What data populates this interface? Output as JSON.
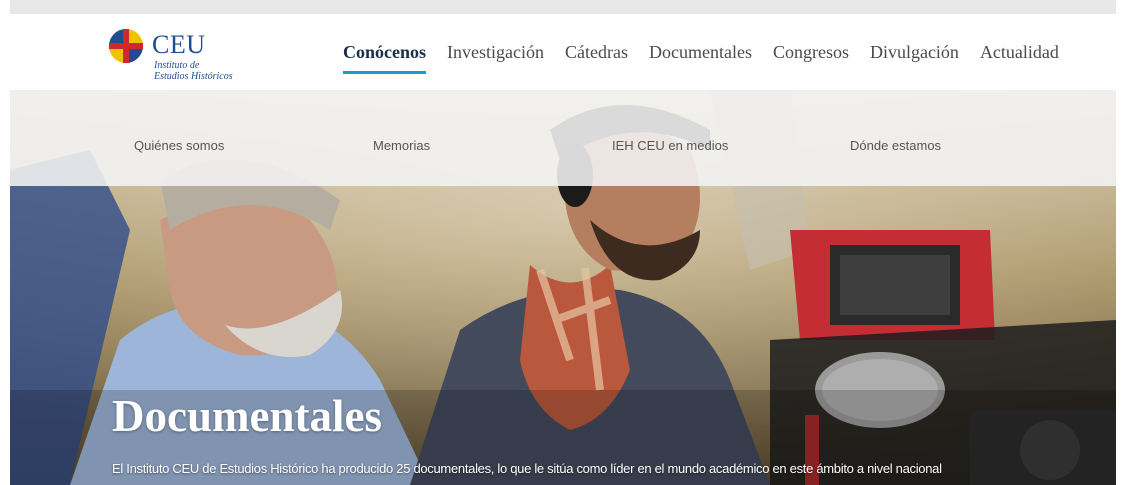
{
  "logo": {
    "name": "CEU",
    "subtitle_line1": "Instituto de",
    "subtitle_line2": "Estudios Históricos",
    "colors": {
      "blue": "#1f4d8f",
      "red": "#d4262c",
      "yellow": "#f2c200"
    }
  },
  "nav": {
    "items": [
      {
        "label": "Conócenos",
        "active": true
      },
      {
        "label": "Investigación",
        "active": false
      },
      {
        "label": "Cátedras",
        "active": false
      },
      {
        "label": "Documentales",
        "active": false
      },
      {
        "label": "Congresos",
        "active": false
      },
      {
        "label": "Divulgación",
        "active": false
      },
      {
        "label": "Actualidad",
        "active": false
      }
    ],
    "active_underline_color": "#1f9ad6"
  },
  "subnav": {
    "items": [
      "Quiénes somos",
      "Memorias",
      "IEH CEU en medios",
      "Dónde estamos"
    ]
  },
  "hero": {
    "title": "Documentales",
    "description": "El Instituto CEU de Estudios Histórico ha producido 25 documentales, lo que le sitúa como líder en el mundo académico en este ámbito a nivel nacional"
  }
}
